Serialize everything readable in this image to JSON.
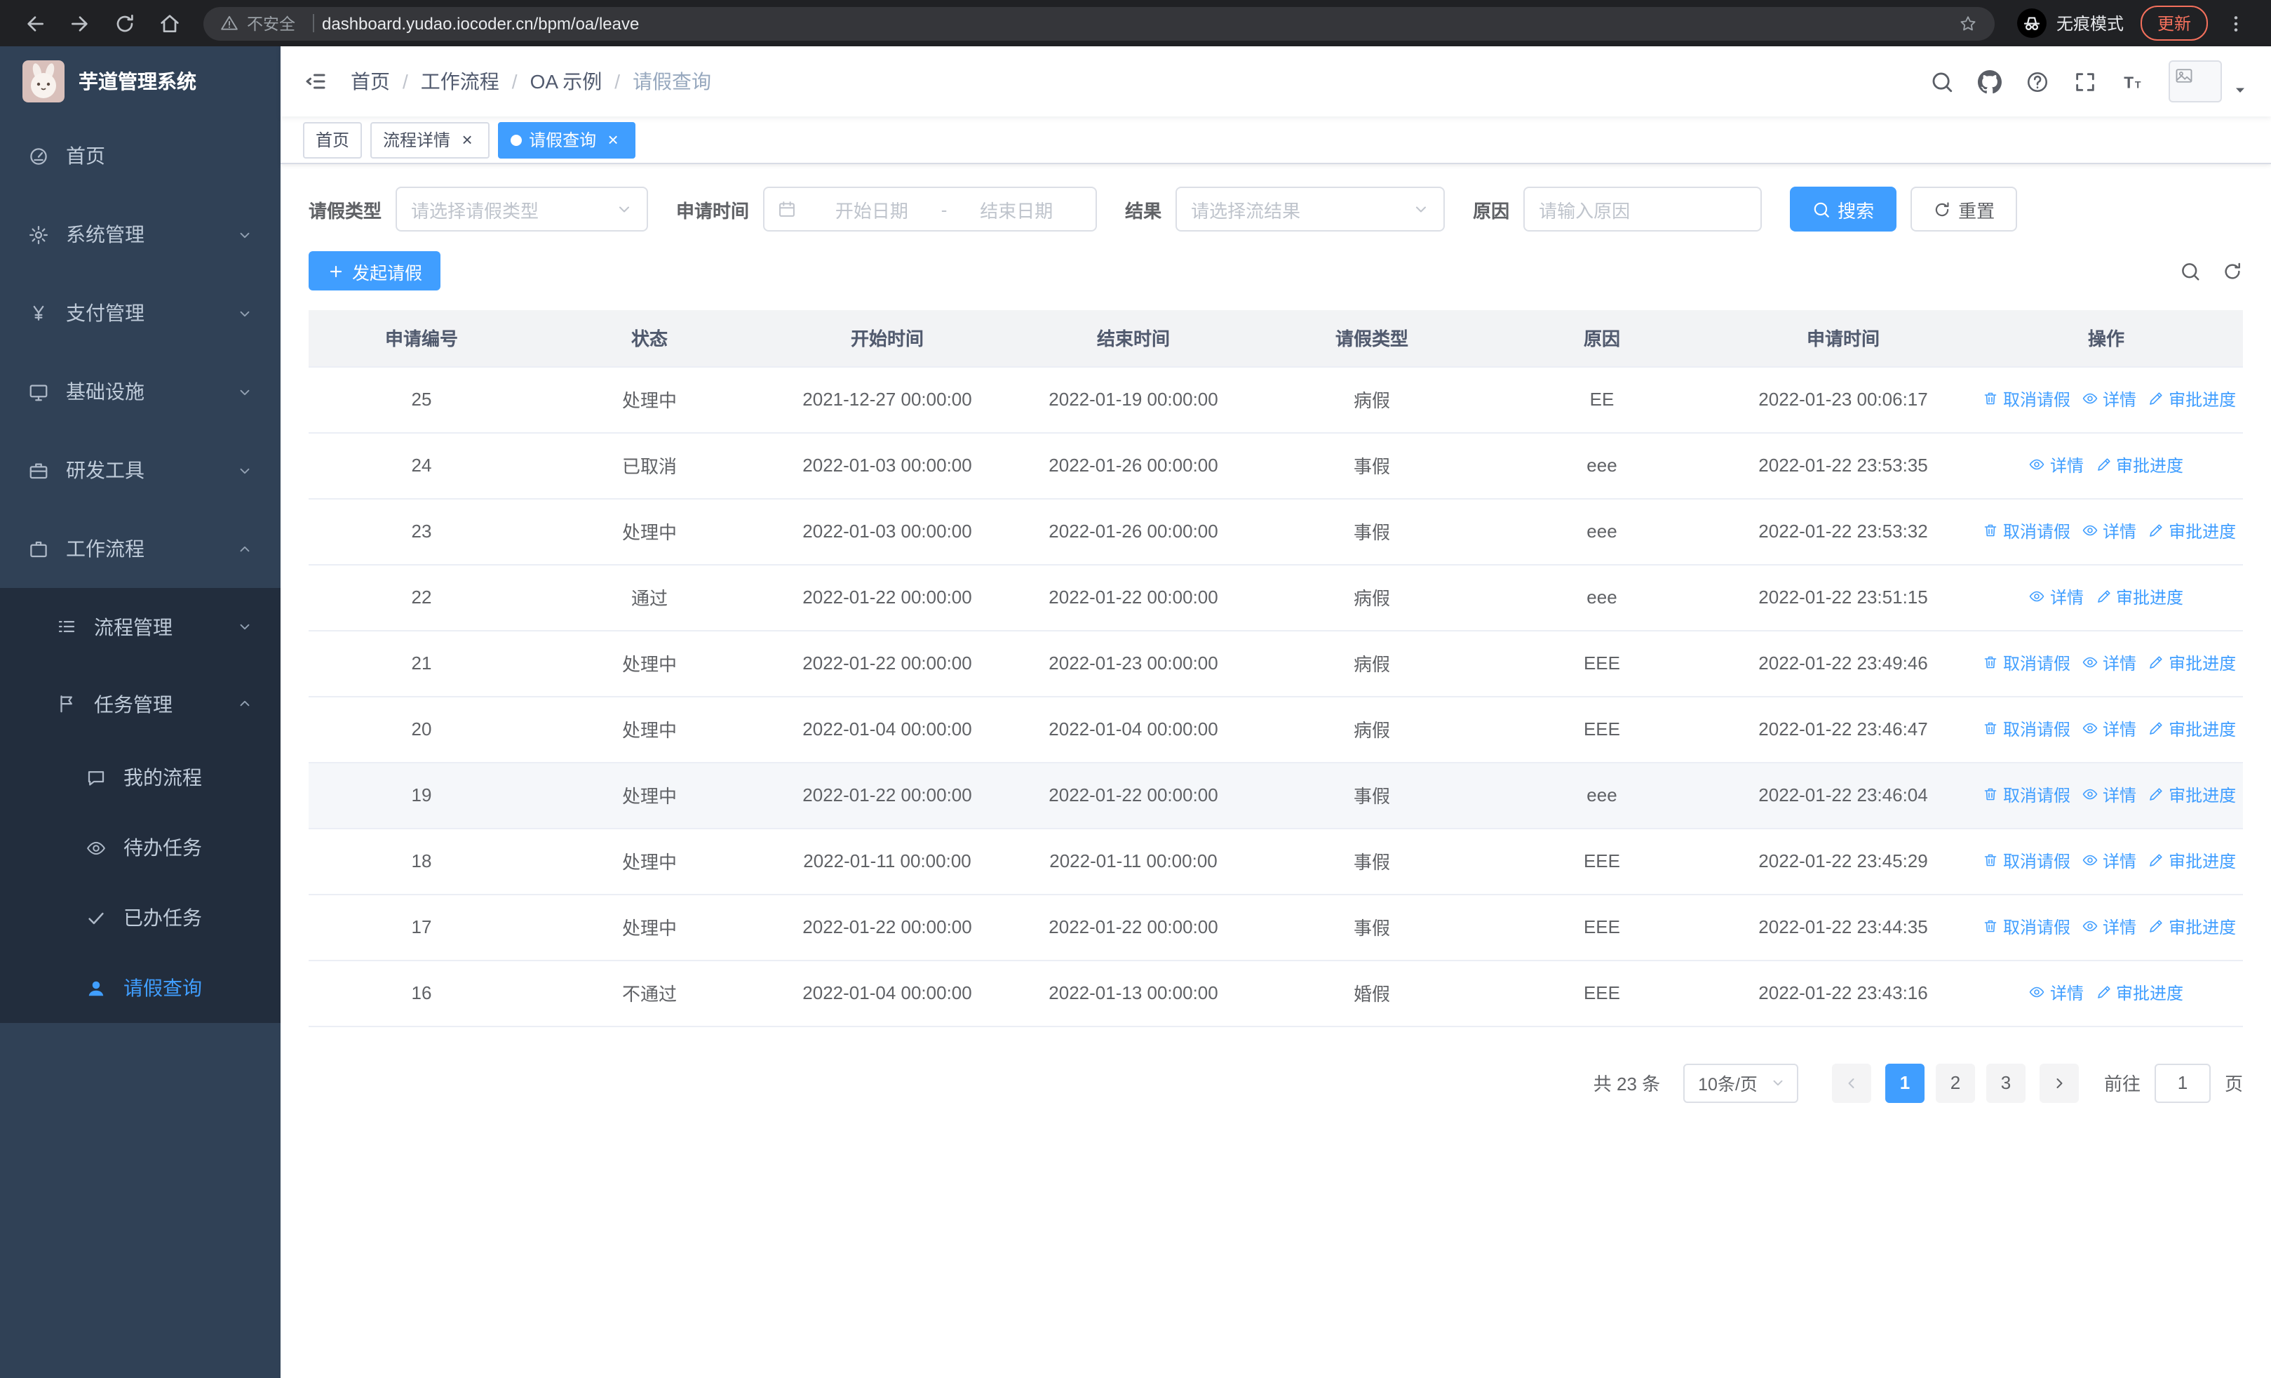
{
  "browser": {
    "security_label": "不安全",
    "url": "dashboard.yudao.iocoder.cn/bpm/oa/leave",
    "incognito_label": "无痕模式",
    "update_label": "更新"
  },
  "sidebar": {
    "app_title": "芋道管理系统",
    "menu": [
      {
        "key": "home",
        "label": "首页",
        "icon": "dashboard",
        "level": 1
      },
      {
        "key": "system",
        "label": "系统管理",
        "icon": "gear",
        "level": 1,
        "arrow": "down"
      },
      {
        "key": "payment",
        "label": "支付管理",
        "icon": "yen",
        "level": 1,
        "arrow": "down"
      },
      {
        "key": "infra",
        "label": "基础设施",
        "icon": "monitor",
        "level": 1,
        "arrow": "down"
      },
      {
        "key": "devtools",
        "label": "研发工具",
        "icon": "toolbox",
        "level": 1,
        "arrow": "down"
      },
      {
        "key": "workflow",
        "label": "工作流程",
        "icon": "briefcase",
        "level": 1,
        "arrow": "up"
      },
      {
        "key": "process-mgmt",
        "label": "流程管理",
        "icon": "list",
        "level": 2,
        "arrow": "down",
        "sub": true
      },
      {
        "key": "task-mgmt",
        "label": "任务管理",
        "icon": "flag",
        "level": 2,
        "arrow": "up",
        "sub": true
      },
      {
        "key": "my-process",
        "label": "我的流程",
        "icon": "chat",
        "level": 3,
        "sub": true
      },
      {
        "key": "todo-tasks",
        "label": "待办任务",
        "icon": "eye",
        "level": 3,
        "sub": true
      },
      {
        "key": "done-tasks",
        "label": "已办任务",
        "icon": "check",
        "level": 3,
        "sub": true
      },
      {
        "key": "leave-query",
        "label": "请假查询",
        "icon": "user",
        "level": 3,
        "sub": true,
        "active": true
      }
    ]
  },
  "header": {
    "breadcrumb": [
      "首页",
      "工作流程",
      "OA 示例",
      "请假查询"
    ]
  },
  "tabs": [
    {
      "key": "home",
      "label": "首页"
    },
    {
      "key": "process-detail",
      "label": "流程详情",
      "closable": true
    },
    {
      "key": "leave-query",
      "label": "请假查询",
      "closable": true,
      "active": true
    }
  ],
  "filters": {
    "leave_type_label": "请假类型",
    "leave_type_placeholder": "请选择请假类型",
    "apply_time_label": "申请时间",
    "start_date_placeholder": "开始日期",
    "range_separator": "-",
    "end_date_placeholder": "结束日期",
    "result_label": "结果",
    "result_placeholder": "请选择流结果",
    "reason_label": "原因",
    "reason_placeholder": "请输入原因",
    "search_label": "搜索",
    "reset_label": "重置"
  },
  "toolbar": {
    "create_label": "发起请假"
  },
  "table": {
    "columns": [
      "申请编号",
      "状态",
      "开始时间",
      "结束时间",
      "请假类型",
      "原因",
      "申请时间",
      "操作"
    ],
    "action_labels": {
      "cancel": "取消请假",
      "detail": "详情",
      "progress": "审批进度"
    },
    "rows": [
      {
        "id": "25",
        "status": "处理中",
        "start": "2021-12-27 00:00:00",
        "end": "2022-01-19 00:00:00",
        "type": "病假",
        "reason": "EE",
        "applied": "2022-01-23 00:06:17",
        "actions": [
          "cancel",
          "detail",
          "progress"
        ]
      },
      {
        "id": "24",
        "status": "已取消",
        "start": "2022-01-03 00:00:00",
        "end": "2022-01-26 00:00:00",
        "type": "事假",
        "reason": "eee",
        "applied": "2022-01-22 23:53:35",
        "actions": [
          "detail",
          "progress"
        ]
      },
      {
        "id": "23",
        "status": "处理中",
        "start": "2022-01-03 00:00:00",
        "end": "2022-01-26 00:00:00",
        "type": "事假",
        "reason": "eee",
        "applied": "2022-01-22 23:53:32",
        "actions": [
          "cancel",
          "detail",
          "progress"
        ]
      },
      {
        "id": "22",
        "status": "通过",
        "start": "2022-01-22 00:00:00",
        "end": "2022-01-22 00:00:00",
        "type": "病假",
        "reason": "eee",
        "applied": "2022-01-22 23:51:15",
        "actions": [
          "detail",
          "progress"
        ]
      },
      {
        "id": "21",
        "status": "处理中",
        "start": "2022-01-22 00:00:00",
        "end": "2022-01-23 00:00:00",
        "type": "病假",
        "reason": "EEE",
        "applied": "2022-01-22 23:49:46",
        "actions": [
          "cancel",
          "detail",
          "progress"
        ]
      },
      {
        "id": "20",
        "status": "处理中",
        "start": "2022-01-04 00:00:00",
        "end": "2022-01-04 00:00:00",
        "type": "病假",
        "reason": "EEE",
        "applied": "2022-01-22 23:46:47",
        "actions": [
          "cancel",
          "detail",
          "progress"
        ]
      },
      {
        "id": "19",
        "status": "处理中",
        "start": "2022-01-22 00:00:00",
        "end": "2022-01-22 00:00:00",
        "type": "事假",
        "reason": "eee",
        "applied": "2022-01-22 23:46:04",
        "actions": [
          "cancel",
          "detail",
          "progress"
        ],
        "highlight": true
      },
      {
        "id": "18",
        "status": "处理中",
        "start": "2022-01-11 00:00:00",
        "end": "2022-01-11 00:00:00",
        "type": "事假",
        "reason": "EEE",
        "applied": "2022-01-22 23:45:29",
        "actions": [
          "cancel",
          "detail",
          "progress"
        ]
      },
      {
        "id": "17",
        "status": "处理中",
        "start": "2022-01-22 00:00:00",
        "end": "2022-01-22 00:00:00",
        "type": "事假",
        "reason": "EEE",
        "applied": "2022-01-22 23:44:35",
        "actions": [
          "cancel",
          "detail",
          "progress"
        ]
      },
      {
        "id": "16",
        "status": "不通过",
        "start": "2022-01-04 00:00:00",
        "end": "2022-01-13 00:00:00",
        "type": "婚假",
        "reason": "EEE",
        "applied": "2022-01-22 23:43:16",
        "actions": [
          "detail",
          "progress"
        ]
      }
    ]
  },
  "pagination": {
    "total_text": "共 23 条",
    "page_size_text": "10条/页",
    "pages": [
      "1",
      "2",
      "3"
    ],
    "active_page": "1",
    "goto_label": "前往",
    "goto_value": "1",
    "goto_suffix": "页"
  },
  "colors": {
    "primary": "#409eff",
    "sidebar_bg": "#304156",
    "submenu_bg": "#222d3d"
  }
}
